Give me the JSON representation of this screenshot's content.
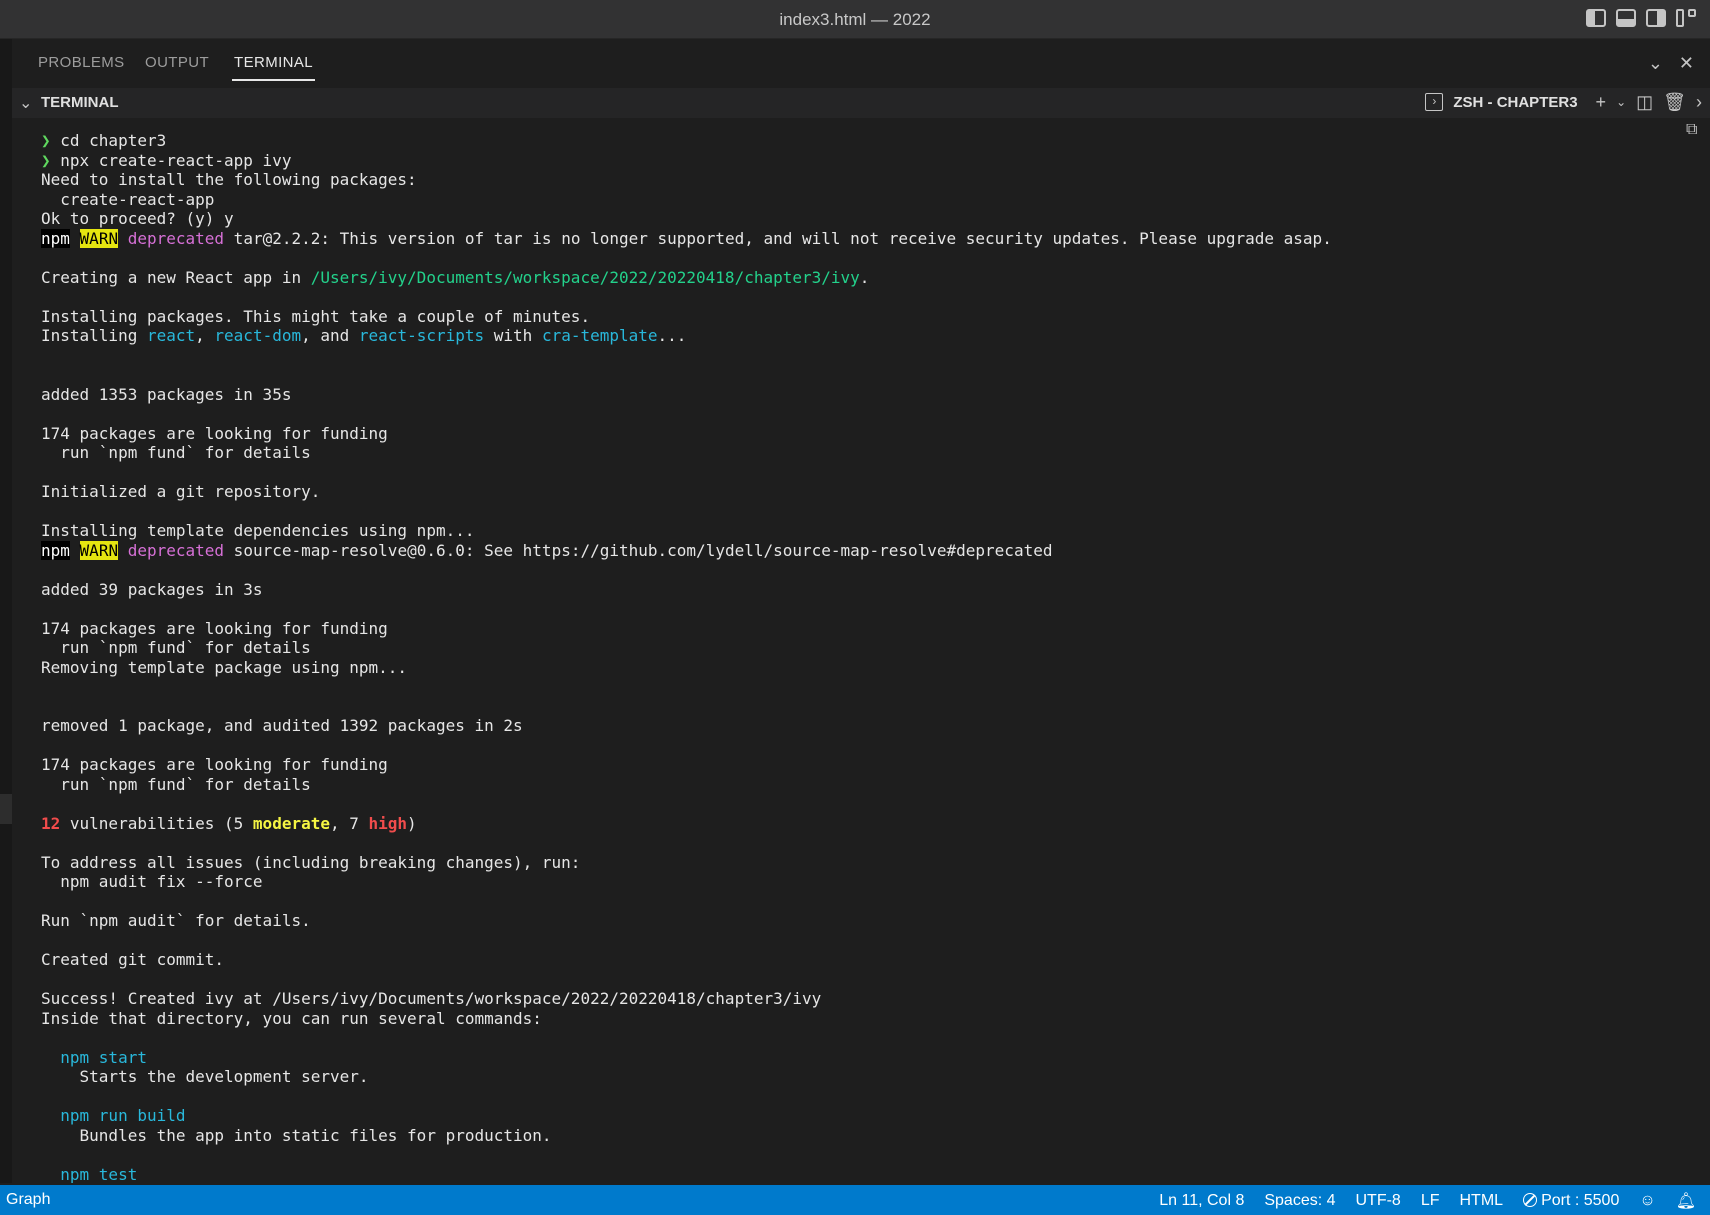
{
  "window": {
    "title": "index3.html — 2022"
  },
  "panel": {
    "tabs": [
      {
        "label": "PROBLEMS"
      },
      {
        "label": "OUTPUT"
      },
      {
        "label": "TERMINAL",
        "active": true
      }
    ]
  },
  "terminal": {
    "header_label": "TERMINAL",
    "shell_name": "ZSH - CHAPTER3",
    "lines": [
      [
        {
          "t": "❯ ",
          "c": "prompt"
        },
        {
          "t": "cd chapter3"
        }
      ],
      [
        {
          "t": "❯ ",
          "c": "prompt"
        },
        {
          "t": "npx create-react-app ivy"
        }
      ],
      [
        {
          "t": "Need to install the following packages:"
        }
      ],
      [
        {
          "t": "  create-react-app"
        }
      ],
      [
        {
          "t": "Ok to proceed? (y) y"
        }
      ],
      [
        {
          "t": "npm",
          "c": "npm-tag"
        },
        {
          "t": " "
        },
        {
          "t": "WARN",
          "c": "warn-tag"
        },
        {
          "t": " "
        },
        {
          "t": "deprecated",
          "c": "purple"
        },
        {
          "t": " tar@2.2.2: This version of tar is no longer supported, and will not receive security updates. Please upgrade asap."
        }
      ],
      [],
      [
        {
          "t": "Creating a new React app in "
        },
        {
          "t": "/Users/ivy/Documents/workspace/2022/20220418/chapter3/ivy",
          "c": "green"
        },
        {
          "t": "."
        }
      ],
      [],
      [
        {
          "t": "Installing packages. This might take a couple of minutes."
        }
      ],
      [
        {
          "t": "Installing "
        },
        {
          "t": "react",
          "c": "cyan"
        },
        {
          "t": ", "
        },
        {
          "t": "react-dom",
          "c": "cyan"
        },
        {
          "t": ", and "
        },
        {
          "t": "react-scripts",
          "c": "cyan"
        },
        {
          "t": " with "
        },
        {
          "t": "cra-template",
          "c": "cyan"
        },
        {
          "t": "..."
        }
      ],
      [],
      [],
      [
        {
          "t": "added 1353 packages in 35s"
        }
      ],
      [],
      [
        {
          "t": "174 packages are looking for funding"
        }
      ],
      [
        {
          "t": "  run `npm fund` for details"
        }
      ],
      [],
      [
        {
          "t": "Initialized a git repository."
        }
      ],
      [],
      [
        {
          "t": "Installing template dependencies using npm..."
        }
      ],
      [
        {
          "t": "npm",
          "c": "npm-tag"
        },
        {
          "t": " "
        },
        {
          "t": "WARN",
          "c": "warn-tag"
        },
        {
          "t": " "
        },
        {
          "t": "deprecated",
          "c": "purple"
        },
        {
          "t": " source-map-resolve@0.6.0: See https://github.com/lydell/source-map-resolve#deprecated"
        }
      ],
      [],
      [
        {
          "t": "added 39 packages in 3s"
        }
      ],
      [],
      [
        {
          "t": "174 packages are looking for funding"
        }
      ],
      [
        {
          "t": "  run `npm fund` for details"
        }
      ],
      [
        {
          "t": "Removing template package using npm..."
        }
      ],
      [],
      [],
      [
        {
          "t": "removed 1 package, and audited 1392 packages in 2s"
        }
      ],
      [],
      [
        {
          "t": "174 packages are looking for funding"
        }
      ],
      [
        {
          "t": "  run `npm fund` for details"
        }
      ],
      [],
      [
        {
          "t": "12",
          "c": "red"
        },
        {
          "t": " vulnerabilities (5 "
        },
        {
          "t": "moderate",
          "c": "yellow"
        },
        {
          "t": ", 7 "
        },
        {
          "t": "high",
          "c": "red-b"
        },
        {
          "t": ")"
        }
      ],
      [],
      [
        {
          "t": "To address all issues (including breaking changes), run:"
        }
      ],
      [
        {
          "t": "  npm audit fix --force"
        }
      ],
      [],
      [
        {
          "t": "Run `npm audit` for details."
        }
      ],
      [],
      [
        {
          "t": "Created git commit."
        }
      ],
      [],
      [
        {
          "t": "Success! Created ivy at /Users/ivy/Documents/workspace/2022/20220418/chapter3/ivy"
        }
      ],
      [
        {
          "t": "Inside that directory, you can run several commands:"
        }
      ],
      [],
      [
        {
          "t": "  "
        },
        {
          "t": "npm start",
          "c": "cyan"
        }
      ],
      [
        {
          "t": "    Starts the development server."
        }
      ],
      [],
      [
        {
          "t": "  "
        },
        {
          "t": "npm run build",
          "c": "cyan"
        }
      ],
      [
        {
          "t": "    Bundles the app into static files for production."
        }
      ],
      [],
      [
        {
          "t": "  "
        },
        {
          "t": "npm test",
          "c": "cyan"
        }
      ]
    ]
  },
  "statusbar": {
    "left": "Graph",
    "position": "Ln 11, Col 8",
    "spaces": "Spaces: 4",
    "encoding": "UTF-8",
    "eol": "LF",
    "language": "HTML",
    "port": "Port : 5500"
  }
}
